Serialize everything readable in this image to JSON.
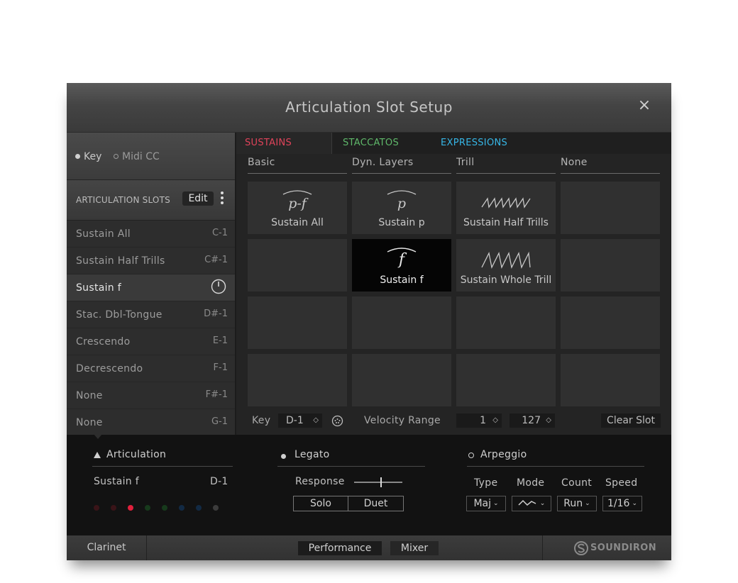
{
  "window": {
    "title": "Articulation Slot Setup",
    "close_glyph": "×"
  },
  "trigger_mode": {
    "key_label": "Key",
    "midi_cc_label": "Midi CC",
    "selected": "Key"
  },
  "slots_header": {
    "label": "ARTICULATION SLOTS",
    "edit_label": "Edit"
  },
  "slots": [
    {
      "name": "Sustain All",
      "key": "C-1"
    },
    {
      "name": "Sustain Half Trills",
      "key": "C#-1"
    },
    {
      "name": "Sustain f",
      "key": "",
      "selected": true
    },
    {
      "name": "Stac. Dbl-Tongue",
      "key": "D#-1"
    },
    {
      "name": "Crescendo",
      "key": "E-1"
    },
    {
      "name": "Decrescendo",
      "key": "F-1"
    },
    {
      "name": "None",
      "key": "F#-1"
    },
    {
      "name": "None",
      "key": "G-1"
    }
  ],
  "tabs": [
    {
      "label": "SUSTAINS",
      "color": "#e0435a",
      "active": true
    },
    {
      "label": "STACCATOS",
      "color": "#5fb86a",
      "active": false
    },
    {
      "label": "EXPRESSIONS",
      "color": "#36b6e6",
      "active": false
    }
  ],
  "categories": [
    "Basic",
    "Dyn. Layers",
    "Trill",
    "None"
  ],
  "grid": {
    "cells": [
      {
        "label": "Sustain All",
        "symbol": "p-f",
        "icon": "dynamic-arc-icon"
      },
      {
        "label": "Sustain p",
        "symbol": "p",
        "icon": "dynamic-arc-icon"
      },
      {
        "label": "Sustain Half Trills",
        "symbol": "",
        "icon": "half-trill-wave-icon"
      },
      {
        "label": "Sustain f",
        "symbol": "f",
        "icon": "dynamic-arc-icon",
        "selected": true
      },
      {
        "label": "Sustain Whole Trill",
        "symbol": "",
        "icon": "whole-trill-wave-icon"
      }
    ]
  },
  "slot_footer": {
    "key_label": "Key",
    "key_value": "D-1",
    "velocity_label": "Velocity Range",
    "velocity_min": "1",
    "velocity_max": "127",
    "clear_label": "Clear Slot",
    "stepper_glyph": "◇"
  },
  "articulation": {
    "title": "Articulation",
    "current": "Sustain f",
    "key": "D-1",
    "dot_colors": [
      "#3a1418",
      "#3a1418",
      "#e0203c",
      "#173a1c",
      "#173a1c",
      "#122a44",
      "#122a44",
      "#3c3c3c",
      "#3c3c3c"
    ]
  },
  "legato": {
    "title": "Legato",
    "response_label": "Response",
    "response_value": 0.55,
    "solo_label": "Solo",
    "duet_label": "Duet"
  },
  "arpeggio": {
    "title": "Arpeggio",
    "columns": [
      {
        "label": "Type",
        "value": "Maj"
      },
      {
        "label": "Mode",
        "value": "up-down-icon"
      },
      {
        "label": "Count",
        "value": "Run"
      },
      {
        "label": "Speed",
        "value": "1/16"
      }
    ]
  },
  "statusbar": {
    "instrument": "Clarinet",
    "performance_label": "Performance",
    "mixer_label": "Mixer",
    "brand": "SOUNDIRON"
  }
}
